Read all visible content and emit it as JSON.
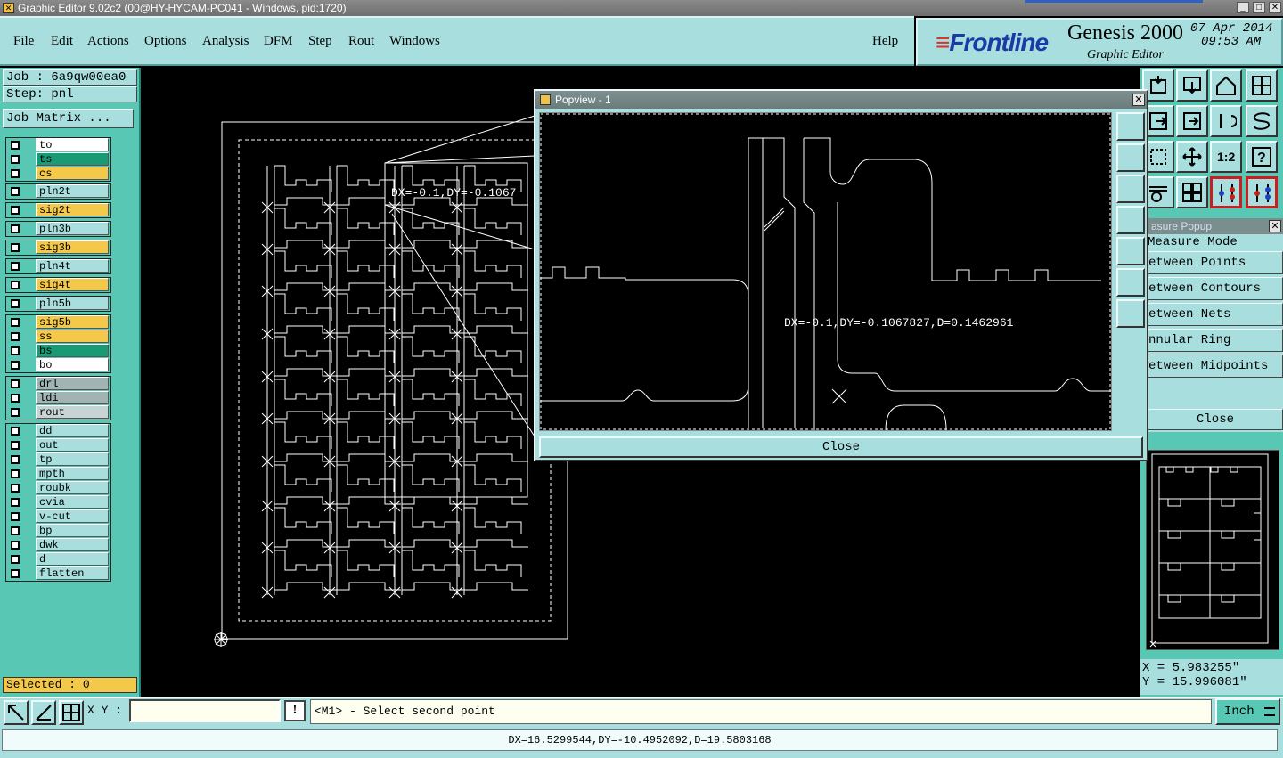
{
  "window": {
    "title": "Graphic Editor 9.02c2 (00@HY-HYCAM-PC041 - Windows, pid:1720)"
  },
  "menu": {
    "items": [
      "File",
      "Edit",
      "Actions",
      "Options",
      "Analysis",
      "DFM",
      "Step",
      "Rout",
      "Windows"
    ],
    "help": "Help"
  },
  "brand": {
    "logo": "Frontline",
    "product": "Genesis 2000",
    "subtitle": "Graphic Editor",
    "date": "07 Apr 2014",
    "time": "09:53 AM"
  },
  "job": {
    "job_label": "Job : 6a9qw00ea0",
    "step_label": "Step: pnl",
    "matrix_button": "Job Matrix ..."
  },
  "layers": {
    "group1": [
      {
        "name": "to",
        "color": "#ffffff"
      },
      {
        "name": "ts",
        "color": "#1a9a74"
      },
      {
        "name": "cs",
        "color": "#f4c848"
      }
    ],
    "group2": [
      {
        "name": "pln2t",
        "color": "#a8dede"
      }
    ],
    "group3": [
      {
        "name": "sig2t",
        "color": "#f4c848"
      }
    ],
    "group4": [
      {
        "name": "pln3b",
        "color": "#a8dede"
      }
    ],
    "group5": [
      {
        "name": "sig3b",
        "color": "#f4c848"
      }
    ],
    "group6": [
      {
        "name": "pln4t",
        "color": "#a8dede"
      }
    ],
    "group7": [
      {
        "name": "sig4t",
        "color": "#f4c848"
      }
    ],
    "group8": [
      {
        "name": "pln5b",
        "color": "#a8dede"
      }
    ],
    "group9": [
      {
        "name": "sig5b",
        "color": "#f4c848"
      },
      {
        "name": "ss",
        "color": "#f4c848"
      },
      {
        "name": "bs",
        "color": "#1a9a74"
      },
      {
        "name": "bo",
        "color": "#ffffff"
      }
    ],
    "group10": [
      {
        "name": "drl",
        "color": "#a0b4b4"
      },
      {
        "name": "ldi",
        "color": "#a0b4b4"
      },
      {
        "name": "rout",
        "color": "#c8d4d4"
      }
    ],
    "group11": [
      {
        "name": "dd",
        "color": "#a8dede"
      },
      {
        "name": "out",
        "color": "#a8dede"
      },
      {
        "name": "tp",
        "color": "#a8dede"
      },
      {
        "name": "mpth",
        "color": "#a8dede"
      },
      {
        "name": "roubk",
        "color": "#a8dede"
      },
      {
        "name": "cvia",
        "color": "#a8dede"
      },
      {
        "name": "v-cut",
        "color": "#a8dede"
      },
      {
        "name": "bp",
        "color": "#a8dede"
      },
      {
        "name": "dwk",
        "color": "#a8dede"
      },
      {
        "name": "d",
        "color": "#a8dede"
      },
      {
        "name": "flatten",
        "color": "#a8dede"
      }
    ]
  },
  "selected": "Selected : 0",
  "canvas": {
    "measure_label": "DX=-0.1,DY=-0.1067"
  },
  "popview": {
    "title": "Popview - 1",
    "measure_label": "DX=-0.1,DY=-0.1067827,D=0.1462961",
    "close": "Close"
  },
  "measure_popup": {
    "title": "asure Popup",
    "items": [
      "Measure Mode",
      "etween Points",
      "etween Contours",
      "etween Nets",
      "nnular Ring",
      "etween Midpoints"
    ],
    "close": "Close"
  },
  "coords": {
    "x": "X = 5.983255\"",
    "y": "Y = 15.996081\""
  },
  "bottom": {
    "xy_label": "X Y :",
    "xy_value": "",
    "bang": "!",
    "prompt": "<M1> - Select second point",
    "unit": "Inch"
  },
  "status": "DX=16.5299544,DY=-10.4952092,D=19.5803168"
}
